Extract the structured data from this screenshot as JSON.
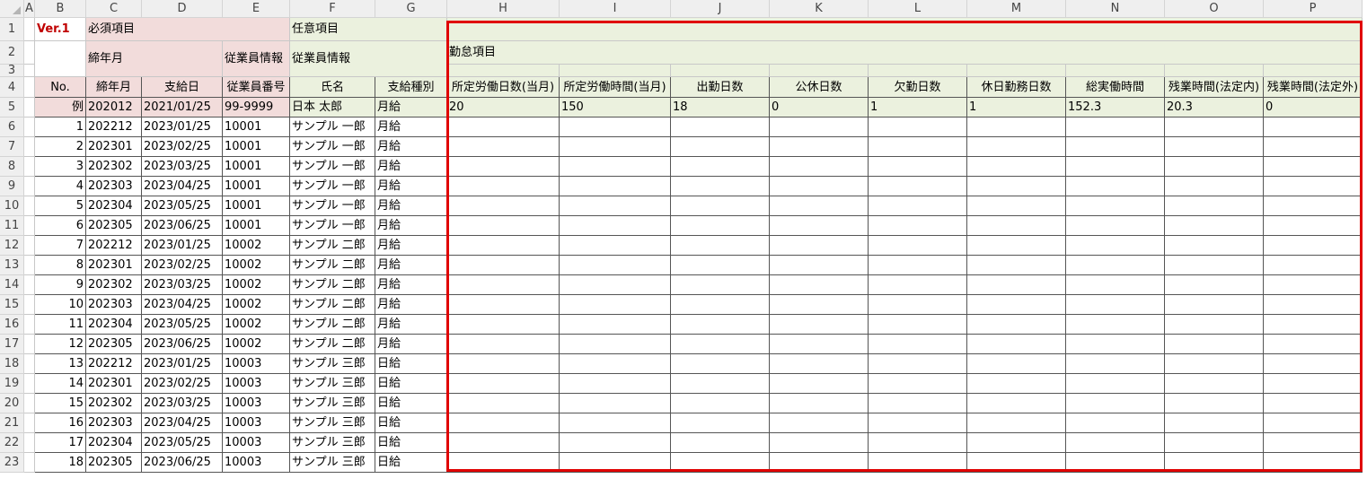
{
  "columns": [
    "A",
    "B",
    "C",
    "D",
    "E",
    "F",
    "G",
    "H",
    "I",
    "J",
    "K",
    "L",
    "M",
    "N",
    "O",
    "P"
  ],
  "row_numbers": [
    "1",
    "2",
    "3",
    "4",
    "5",
    "6",
    "7",
    "8",
    "9",
    "10",
    "11",
    "12",
    "13",
    "14",
    "15",
    "16",
    "17",
    "18",
    "19",
    "20",
    "21",
    "22",
    "23"
  ],
  "banner": {
    "version": "Ver.1",
    "required_label": "必須項目",
    "optional_label": "任意項目",
    "closing_month_group": "締年月",
    "employee_info_group": "従業員情報",
    "employee_info_group2": "従業員情報",
    "attendance_group": "勤怠項目"
  },
  "headers": [
    "No.",
    "締年月",
    "支給日",
    "従業員番号",
    "氏名",
    "支給種別",
    "所定労働日数(当月)",
    "所定労働時間(当月)",
    "出勤日数",
    "公休日数",
    "欠勤日数",
    "休日勤務日数",
    "総実働時間",
    "残業時間(法定内)",
    "残業時間(法定外)"
  ],
  "example_row": [
    "例",
    "202012",
    "2021/01/25",
    "99-9999",
    "日本 太郎",
    "月給",
    "20",
    "150",
    "18",
    "0",
    "1",
    "1",
    "152.3",
    "20.3",
    "0"
  ],
  "rows": [
    [
      "1",
      "202212",
      "2023/01/25",
      "10001",
      "サンプル 一郎",
      "月給"
    ],
    [
      "2",
      "202301",
      "2023/02/25",
      "10001",
      "サンプル 一郎",
      "月給"
    ],
    [
      "3",
      "202302",
      "2023/03/25",
      "10001",
      "サンプル 一郎",
      "月給"
    ],
    [
      "4",
      "202303",
      "2023/04/25",
      "10001",
      "サンプル 一郎",
      "月給"
    ],
    [
      "5",
      "202304",
      "2023/05/25",
      "10001",
      "サンプル 一郎",
      "月給"
    ],
    [
      "6",
      "202305",
      "2023/06/25",
      "10001",
      "サンプル 一郎",
      "月給"
    ],
    [
      "7",
      "202212",
      "2023/01/25",
      "10002",
      "サンプル 二郎",
      "月給"
    ],
    [
      "8",
      "202301",
      "2023/02/25",
      "10002",
      "サンプル 二郎",
      "月給"
    ],
    [
      "9",
      "202302",
      "2023/03/25",
      "10002",
      "サンプル 二郎",
      "月給"
    ],
    [
      "10",
      "202303",
      "2023/04/25",
      "10002",
      "サンプル 二郎",
      "月給"
    ],
    [
      "11",
      "202304",
      "2023/05/25",
      "10002",
      "サンプル 二郎",
      "月給"
    ],
    [
      "12",
      "202305",
      "2023/06/25",
      "10002",
      "サンプル 二郎",
      "月給"
    ],
    [
      "13",
      "202212",
      "2023/01/25",
      "10003",
      "サンプル 三郎",
      "日給"
    ],
    [
      "14",
      "202301",
      "2023/02/25",
      "10003",
      "サンプル 三郎",
      "日給"
    ],
    [
      "15",
      "202302",
      "2023/03/25",
      "10003",
      "サンプル 三郎",
      "日給"
    ],
    [
      "16",
      "202303",
      "2023/04/25",
      "10003",
      "サンプル 三郎",
      "日給"
    ],
    [
      "17",
      "202304",
      "2023/05/25",
      "10003",
      "サンプル 三郎",
      "日給"
    ],
    [
      "18",
      "202305",
      "2023/06/25",
      "10003",
      "サンプル 三郎",
      "日給"
    ]
  ],
  "colors": {
    "required_fill": "#f2dcdb",
    "optional_fill": "#ebf1de",
    "version_text": "#c00000",
    "highlight_border": "#e00000"
  }
}
